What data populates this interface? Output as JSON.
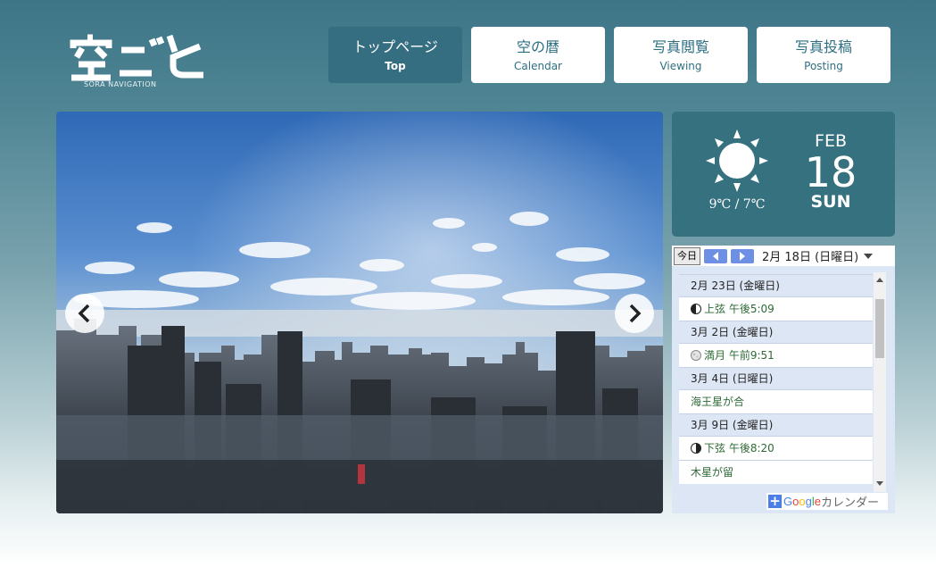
{
  "logo": {
    "title": "空ごと",
    "subtitle": "SORA NAVIGATION"
  },
  "nav": [
    {
      "jp": "トップページ",
      "en": "Top",
      "active": true
    },
    {
      "jp": "空の暦",
      "en": "Calendar",
      "active": false
    },
    {
      "jp": "写真閲覧",
      "en": "Viewing",
      "active": false
    },
    {
      "jp": "写真投稿",
      "en": "Posting",
      "active": false
    }
  ],
  "slider": {
    "prev_icon": "chevron-left-icon",
    "next_icon": "chevron-right-icon"
  },
  "weather": {
    "icon": "sun-icon",
    "temp": "9℃ / 7℃",
    "month": "FEB",
    "day": "18",
    "weekday": "SUN"
  },
  "calendar": {
    "today_label": "今日",
    "current_date": "2月 18日 (日曜日)",
    "days": [
      {
        "date": "2月 23日 (金曜日)",
        "events": [
          {
            "text": "上弦 午後5:09",
            "moon": "first-quarter"
          }
        ]
      },
      {
        "date": "3月 2日 (金曜日)",
        "events": [
          {
            "text": "満月 午前9:51",
            "moon": "full"
          }
        ]
      },
      {
        "date": "3月 4日 (日曜日)",
        "events": [
          {
            "text": "海王星が合",
            "moon": ""
          }
        ]
      },
      {
        "date": "3月 9日 (金曜日)",
        "events": [
          {
            "text": "下弦 午後8:20",
            "moon": "last-quarter"
          },
          {
            "text": "木星が留",
            "moon": ""
          }
        ]
      }
    ],
    "footer_google": "Google",
    "footer_label": "カレンダー"
  },
  "colors": {
    "accent": "#356e80",
    "nav_text": "#2f6f82",
    "event_text": "#2e6a36",
    "calendar_bg": "#dde6f4"
  }
}
